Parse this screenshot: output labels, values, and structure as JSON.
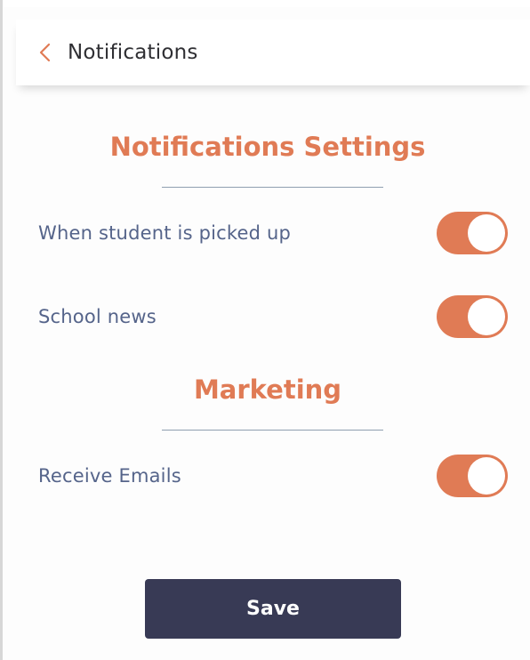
{
  "header": {
    "title": "Notifications",
    "back_icon": "chevron-left-icon"
  },
  "notifications_section": {
    "title": "Notifications Settings",
    "items": [
      {
        "label": "When student is picked up",
        "enabled": true
      },
      {
        "label": "School news",
        "enabled": true
      }
    ]
  },
  "marketing_section": {
    "title": "Marketing",
    "items": [
      {
        "label": "Receive Emails",
        "enabled": true
      }
    ]
  },
  "actions": {
    "save_label": "Save"
  },
  "colors": {
    "accent": "#e07b55",
    "label_text": "#55648a",
    "button_bg": "#383a55",
    "divider": "#8f9fb0"
  }
}
